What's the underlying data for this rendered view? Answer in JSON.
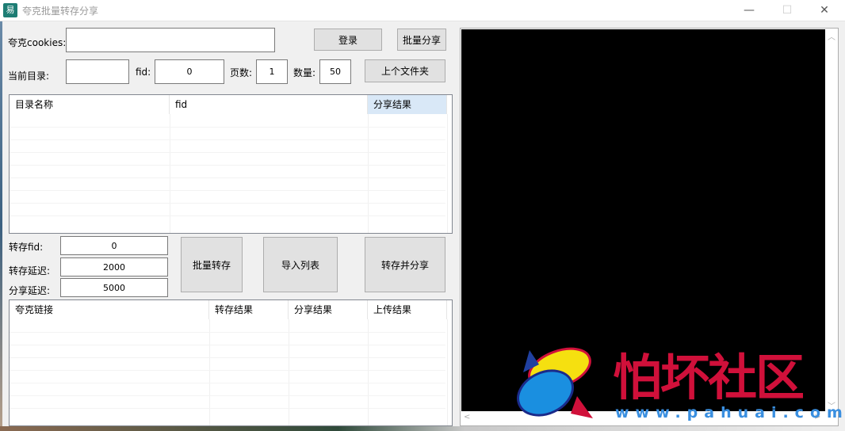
{
  "window": {
    "title": "夸克批量转存分享",
    "minimize": "—",
    "maximize": "☐",
    "close": "✕"
  },
  "form": {
    "cookies_label": "夸克cookies:",
    "cookies_value": "",
    "login_button": "登录",
    "batch_share_button": "批量分享",
    "current_dir_label": "当前目录:",
    "current_dir_value": "",
    "fid_label": "fid:",
    "fid_value": "0",
    "page_label": "页数:",
    "page_value": "1",
    "count_label": "数量:",
    "count_value": "50",
    "parent_folder_button": "上个文件夹"
  },
  "dir_table": {
    "columns": [
      "目录名称",
      "fid",
      "分享结果"
    ],
    "rows": []
  },
  "transfer": {
    "fid_label": "转存fid:",
    "fid_value": "0",
    "delay_label": "转存延迟:",
    "delay_value": "2000",
    "share_delay_label": "分享延迟:",
    "share_delay_value": "5000",
    "batch_transfer_button": "批量转存",
    "import_list_button": "导入列表",
    "transfer_share_button": "转存并分享"
  },
  "link_table": {
    "columns": [
      "夸克链接",
      "转存结果",
      "分享结果",
      "上传结果"
    ],
    "rows": []
  },
  "watermark": {
    "text": "怕坏社区",
    "url": "www.pahuai.com"
  },
  "colors": {
    "header_highlight": "#d9e8f7",
    "watermark_red": "#d0103a",
    "watermark_blue": "#3a8fe0"
  }
}
